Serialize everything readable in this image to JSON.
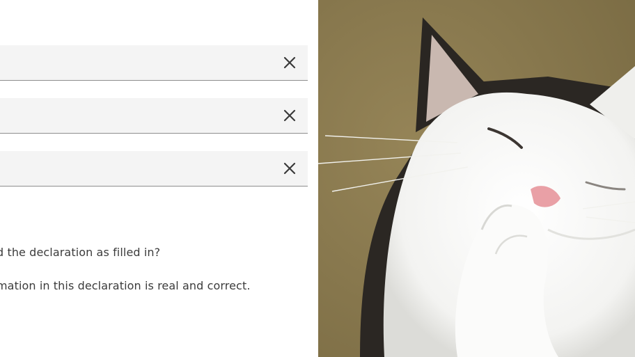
{
  "form": {
    "fields": [
      {
        "value": "",
        "clear_icon": "close-icon"
      },
      {
        "value": "",
        "clear_icon": "close-icon"
      },
      {
        "value": "",
        "clear_icon": "close-icon"
      }
    ],
    "question_text": "d the declaration as filled in?",
    "confirm_text": "mation in this declaration is real and correct."
  },
  "photo": {
    "subject": "cat-photo",
    "colors": {
      "background": "#8a7a4f",
      "fur": "#f6f6f4",
      "dark_fur": "#2a2622"
    }
  }
}
